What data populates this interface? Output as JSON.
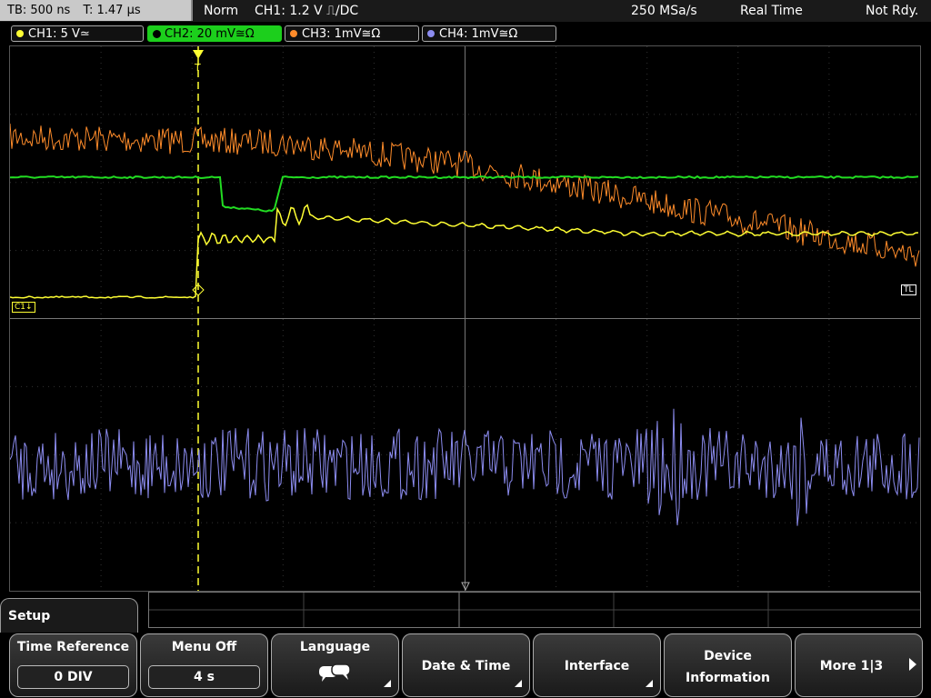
{
  "topbar": {
    "timebase": "TB: 500 ns",
    "trigger_time": "T: 1.47 µs",
    "mode": "Norm",
    "trigger": "CH1: 1.2 V ⎍/DC",
    "sample_rate": "250 MSa/s",
    "acq_mode": "Real Time",
    "status": "Not Rdy."
  },
  "channels": [
    {
      "label": "CH1: 5 V≃",
      "color": "#ffff33"
    },
    {
      "label": "CH2: 20 mV≅Ω",
      "color": "#22dd22"
    },
    {
      "label": "CH3: 1mV≅Ω",
      "color": "#ff8c2a"
    },
    {
      "label": "CH4: 1mV≅Ω",
      "color": "#8c8cf0"
    }
  ],
  "markers": {
    "c1": "C1",
    "tl": "TL",
    "trigger": "T"
  },
  "menu": {
    "title": "Setup",
    "softkeys": [
      {
        "label": "Time Reference",
        "value": "0 DIV"
      },
      {
        "label": "Menu Off",
        "value": "4 s"
      },
      {
        "label": "Language"
      },
      {
        "label": "Date & Time"
      },
      {
        "label": "Interface"
      },
      {
        "label_line1": "Device",
        "label_line2": "Information"
      },
      {
        "label": "More 1|3"
      }
    ]
  }
}
